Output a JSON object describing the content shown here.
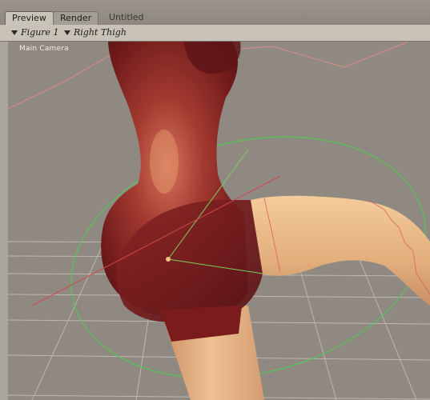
{
  "tabs": [
    {
      "label": "Preview",
      "active": true
    },
    {
      "label": "Render",
      "active": false
    }
  ],
  "document_title": "Untitled",
  "toolbar": {
    "figure_selector": "Figure 1",
    "part_selector": "Right Thigh"
  },
  "viewport": {
    "camera_label": "Main Camera"
  },
  "colors": {
    "background": "#8f8982",
    "figure_red": "#7e1f1e",
    "skin": "#e9b98a",
    "rotation_ring": "#3fbf3f",
    "guide_line": "#d07070"
  }
}
